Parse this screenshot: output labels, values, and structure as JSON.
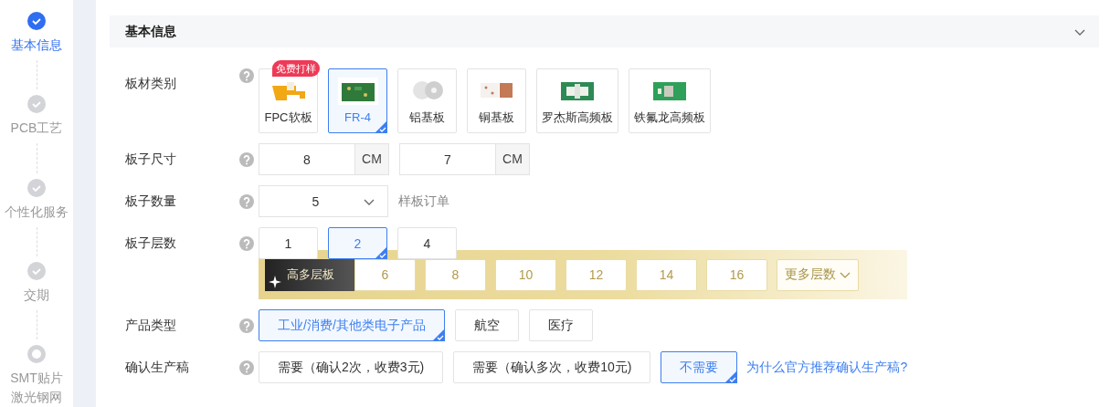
{
  "steps": [
    {
      "lines": [
        "基本信息"
      ],
      "selected": true,
      "completed": true
    },
    {
      "lines": [
        "PCB工艺"
      ],
      "selected": false,
      "completed": true
    },
    {
      "lines": [
        "个性化服务"
      ],
      "selected": false,
      "completed": true
    },
    {
      "lines": [
        "交期"
      ],
      "selected": false,
      "completed": true
    },
    {
      "lines": [
        "SMT贴片",
        "激光钢网"
      ],
      "selected": false,
      "completed": false
    }
  ],
  "section": {
    "title": "基本信息",
    "expanded": true
  },
  "material": {
    "label": "板材类别",
    "options": [
      {
        "name": "FPC软板",
        "badge": "免费打样",
        "selected": false,
        "kind": "flex"
      },
      {
        "name": "FR-4",
        "selected": true,
        "kind": "green"
      },
      {
        "name": "铝基板",
        "selected": false,
        "kind": "aluminum"
      },
      {
        "name": "铜基板",
        "selected": false,
        "kind": "copper"
      },
      {
        "name": "罗杰斯高频板",
        "selected": false,
        "kind": "rogers"
      },
      {
        "name": "铁氟龙高频板",
        "selected": false,
        "kind": "teflon"
      }
    ]
  },
  "size": {
    "label": "板子尺寸",
    "fields": [
      {
        "value": "8",
        "unit": "CM"
      },
      {
        "value": "7",
        "unit": "CM"
      }
    ]
  },
  "quantity": {
    "label": "板子数量",
    "value": "5",
    "note": "样板订单"
  },
  "layers": {
    "label": "板子层数",
    "options": [
      {
        "text": "1",
        "selected": false
      },
      {
        "text": "2",
        "selected": true
      },
      {
        "text": "4",
        "selected": false
      }
    ],
    "premium": {
      "title": "高多层板",
      "options": [
        {
          "text": "6",
          "selected": false
        },
        {
          "text": "8",
          "selected": false
        },
        {
          "text": "10",
          "selected": false
        },
        {
          "text": "12",
          "selected": false
        },
        {
          "text": "14",
          "selected": false
        },
        {
          "text": "16",
          "selected": false
        }
      ],
      "more": "更多层数"
    }
  },
  "product_type": {
    "label": "产品类型",
    "options": [
      {
        "text": "工业/消费/其他类电子产品",
        "selected": true
      },
      {
        "text": "航空",
        "selected": false
      },
      {
        "text": "医疗",
        "selected": false
      }
    ]
  },
  "confirm": {
    "label": "确认生产稿",
    "options": [
      {
        "text": "需要（确认2次，收费3元)",
        "selected": false
      },
      {
        "text": "需要（确认多次，收费10元)",
        "selected": false
      },
      {
        "text": "不需要",
        "selected": true
      }
    ],
    "link": "为什么官方推荐确认生产稿?"
  }
}
